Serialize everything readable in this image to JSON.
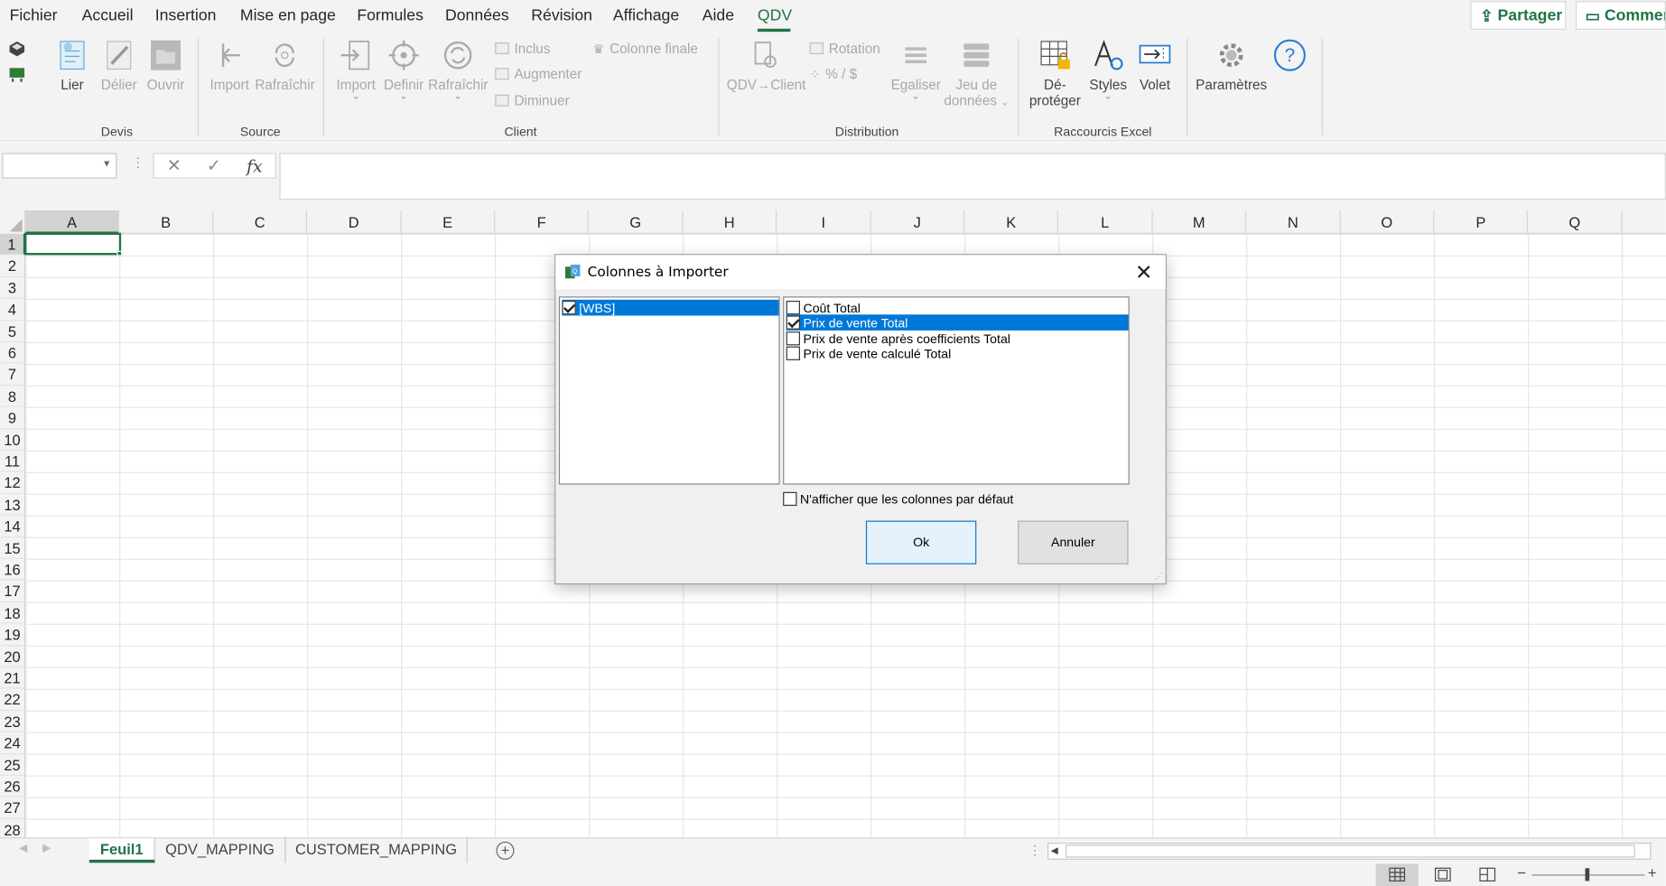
{
  "menu": {
    "tabs": [
      "Fichier",
      "Accueil",
      "Insertion",
      "Mise en page",
      "Formules",
      "Données",
      "Révision",
      "Affichage",
      "Aide",
      "QDV"
    ],
    "active_tab": "QDV",
    "share_label": "Partager",
    "comments_label": "Commen"
  },
  "ribbon": {
    "groups": {
      "devis": "Devis",
      "source": "Source",
      "client": "Client",
      "distribution": "Distribution",
      "raccourcis": "Raccourcis Excel"
    },
    "buttons": {
      "lier": "Lier",
      "delier": "Délier",
      "ouvrir": "Ouvrir",
      "import_source": "Import",
      "rafraichir_source": "Rafraîchir",
      "import_client": "Import",
      "definir": "Definir",
      "rafraichir_client": "Rafraîchir",
      "inclus": "Inclus",
      "augmenter": "Augmenter",
      "diminuer": "Diminuer",
      "colonne_finale": "Colonne finale",
      "qdv_client": "QDV→Client",
      "rotation": "Rotation",
      "pct": "% / $",
      "egaliser": "Egaliser",
      "jeu_de": "Jeu de",
      "donnees": "données",
      "de": "Dé-",
      "proteger": "protéger",
      "styles": "Styles",
      "volet": "Volet",
      "parametres": "Paramètres"
    }
  },
  "formula_bar": {
    "name_box": "",
    "cancel_icon": "✕",
    "enter_icon": "✓",
    "fx": "fx",
    "value": ""
  },
  "grid": {
    "columns": [
      "A",
      "B",
      "C",
      "D",
      "E",
      "F",
      "G",
      "H",
      "I",
      "J",
      "K",
      "L",
      "M",
      "N",
      "O",
      "P",
      "Q"
    ],
    "rows": [
      "1",
      "2",
      "3",
      "4",
      "5",
      "6",
      "7",
      "8",
      "9",
      "10",
      "11",
      "12",
      "13",
      "14",
      "15",
      "16",
      "17",
      "18",
      "19",
      "20",
      "21",
      "22",
      "23",
      "24",
      "25",
      "26",
      "27",
      "28"
    ],
    "selected_cell": "A1"
  },
  "sheets": {
    "tabs": [
      "Feuil1",
      "QDV_MAPPING",
      "CUSTOMER_MAPPING"
    ],
    "active": "Feuil1",
    "add": "+"
  },
  "dialog": {
    "title": "Colonnes à Importer",
    "left_items": [
      {
        "label": "[WBS]",
        "checked": true,
        "selected": true
      }
    ],
    "right_items": [
      {
        "label": "Coût Total",
        "checked": false,
        "selected": false
      },
      {
        "label": "Prix de vente Total",
        "checked": true,
        "selected": true
      },
      {
        "label": "Prix de vente après coefficients Total",
        "checked": false,
        "selected": false
      },
      {
        "label": "Prix de vente calculé Total",
        "checked": false,
        "selected": false
      }
    ],
    "default_only_label": "N'afficher que les colonnes par défaut",
    "default_only_checked": false,
    "ok_label": "Ok",
    "cancel_label": "Annuler"
  },
  "colors": {
    "excel_green": "#217346",
    "selection_blue": "#0078d7"
  }
}
